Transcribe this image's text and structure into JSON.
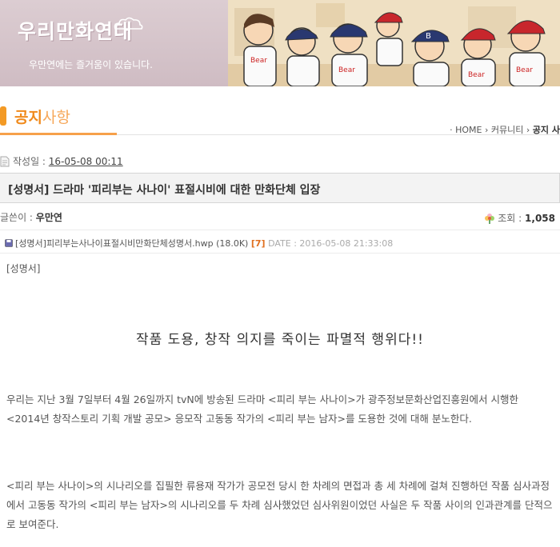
{
  "banner": {
    "logo_title": "우리만화연대",
    "tagline": "우만연에는 즐거움이 있습니다."
  },
  "section": {
    "title_bold": "공지",
    "title_rest": "사항"
  },
  "breadcrumb": {
    "home": "HOME",
    "community": "커뮤니티",
    "current": "공지 사"
  },
  "post": {
    "date_label": "작성일 : ",
    "date_value": "16-05-08 00:11",
    "title": "[성명서] 드라마 '피리부는 사나이' 표절시비에 대한 만화단체 입장",
    "author_label": "글쓴이 : ",
    "author": "우만연",
    "views_label": "조회 : ",
    "views": "1,058",
    "attachment": {
      "filename": "[성명서]피리부는사나이표절시비만화단체성명서.hwp",
      "size": "(18.0K)",
      "downloads": "[7]",
      "date": "DATE : 2016-05-08 21:33:08"
    },
    "body": {
      "tag": "[성명서]",
      "headline": "작품 도용, 창작 의지를 죽이는 파멸적 행위다!!",
      "paragraph1": "우리는 지난 3월 7일부터 4월 26일까지 tvN에 방송된 드라마 <피리 부는 사나이>가 광주정보문화산업진흥원에서 시행한 <2014년 창작스토리 기획 개발 공모> 응모작 고동동 작가의 <피리 부는 남자>를 도용한 것에 대해 분노한다.",
      "paragraph2": "<피리 부는 사나이>의 시나리오를 집필한 류용재 작가가 공모전 당시 한 차례의 면접과 총 세 차례에 걸쳐 진행하던 작품 심사과정에서 고동동 작가의 <피리 부는 남자>의 시나리오를 두 차례 심사했었던 심사위원이었던 사실은 두 작품 사이의 인과관계를 단적으로 보여준다."
    }
  },
  "colors": {
    "accent": "#f08a1c",
    "banner_bg": "#d3c3c8"
  }
}
